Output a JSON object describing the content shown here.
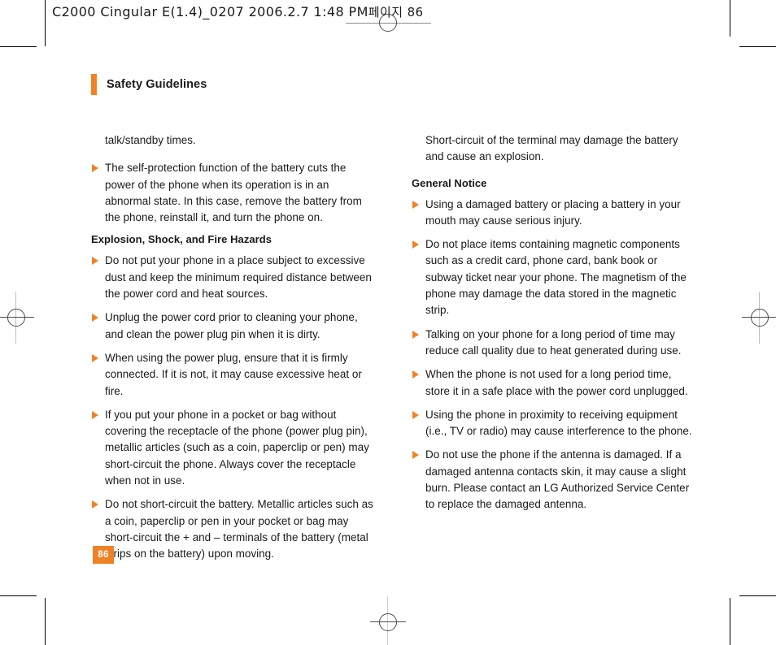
{
  "scan_header": {
    "text": "C2000 Cingular  E(1.4)_0207  2006.2.7 1:48 PM",
    "korean_suffix": "페이지 86"
  },
  "chapter": {
    "title": "Safety Guidelines"
  },
  "colors": {
    "accent_orange": "#F08226",
    "body_text": "#1a1a1a",
    "crop_mark": "#000000",
    "registration_mark": "#4a4a4a"
  },
  "page_number": "86",
  "left_column": [
    {
      "type": "continued-paragraph",
      "text": "talk/standby times."
    },
    {
      "type": "bullet",
      "text": "The self-protection function of the battery cuts the power of the phone when its operation is in an abnormal state. In this case, remove the battery from the phone, reinstall it, and turn the phone on."
    },
    {
      "type": "subheading",
      "text": "Explosion, Shock, and Fire Hazards"
    },
    {
      "type": "bullet",
      "text": "Do not put your phone in a place subject to excessive dust and keep the minimum required distance between the power cord and heat sources."
    },
    {
      "type": "bullet",
      "text": "Unplug the power cord prior to cleaning your phone, and clean the power plug pin when it is dirty."
    },
    {
      "type": "bullet",
      "text": "When using the power plug, ensure that it is firmly connected. If it is not, it may cause excessive heat or fire."
    },
    {
      "type": "bullet",
      "text": "If you put your phone in a pocket or bag without covering the receptacle of the phone (power plug pin), metallic articles (such as a coin, paperclip or pen) may short-circuit the phone. Always cover the receptacle when not in use."
    },
    {
      "type": "bullet",
      "text": "Do not short-circuit the battery. Metallic articles such as a coin, paperclip or pen in your pocket or bag may short-circuit the + and – terminals of the battery (metal strips on the battery) upon moving."
    }
  ],
  "right_column": [
    {
      "type": "continued-paragraph",
      "text": "Short-circuit of the terminal may damage the battery and cause an explosion."
    },
    {
      "type": "subheading",
      "text": "General Notice"
    },
    {
      "type": "bullet",
      "text": "Using a damaged battery or placing a battery in your mouth may cause serious injury."
    },
    {
      "type": "bullet",
      "text": "Do not place items containing magnetic components such as a credit card, phone card, bank book or subway ticket near your phone. The magnetism of the phone may damage the data stored in the magnetic strip."
    },
    {
      "type": "bullet",
      "text": "Talking on your phone for a long period of time may reduce call quality due to heat generated during use."
    },
    {
      "type": "bullet",
      "text": "When the phone is not used for a long period time, store it in a safe place with the power cord unplugged."
    },
    {
      "type": "bullet",
      "text": "Using the phone in proximity to receiving equipment (i.e., TV or radio) may cause interference to the phone."
    },
    {
      "type": "bullet",
      "text": "Do not use the phone if the antenna is damaged. If a damaged antenna contacts skin, it may cause a slight burn. Please contact an LG Authorized Service Center to replace the damaged antenna."
    }
  ]
}
